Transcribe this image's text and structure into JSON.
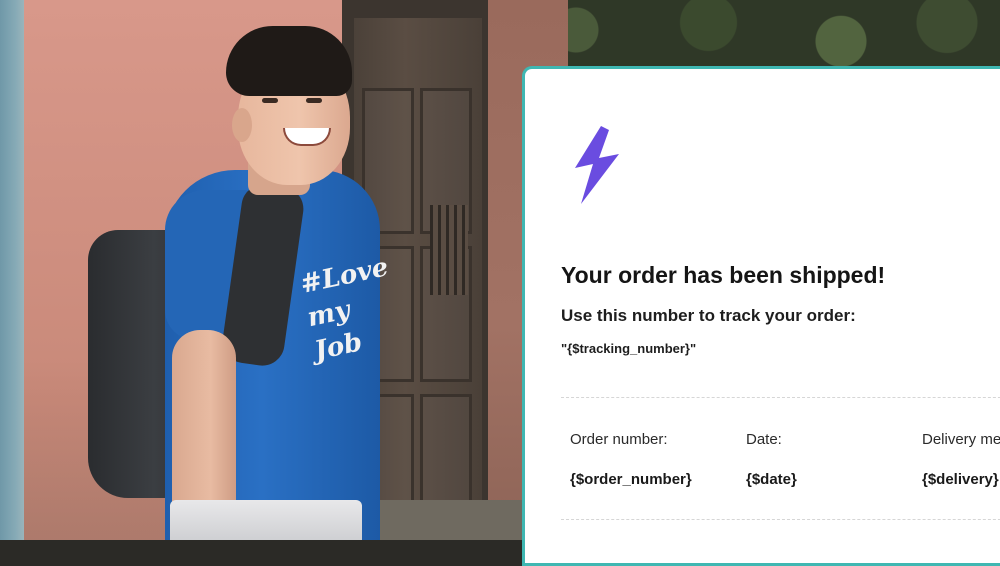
{
  "email": {
    "headline": "Your order has been shipped!",
    "subheadline": "Use this number to track your order:",
    "tracking_value": "\"{$tracking_number}\"",
    "details": {
      "order_label": "Order number:",
      "order_value": "{$order_number}",
      "date_label": "Date:",
      "date_value": "{$date}",
      "delivery_label": "Delivery me",
      "delivery_value": "{$delivery}"
    }
  },
  "photo": {
    "shirt_print": "#Love my Job"
  },
  "colors": {
    "card_border": "#3fb7b2",
    "bolt": "#6a4ce0",
    "shirt": "#2a70c4"
  },
  "icons": {
    "logo": "lightning-bolt-icon"
  }
}
